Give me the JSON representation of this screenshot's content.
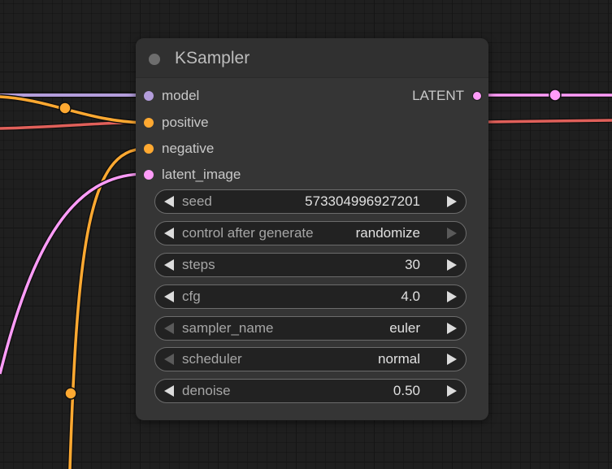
{
  "node": {
    "title": "KSampler",
    "inputs": [
      {
        "label": "model",
        "color": "#b39ddb"
      },
      {
        "label": "positive",
        "color": "#ffa931"
      },
      {
        "label": "negative",
        "color": "#ffa931"
      },
      {
        "label": "latent_image",
        "color": "#ff9cf9"
      }
    ],
    "outputs": [
      {
        "label": "LATENT",
        "color": "#ff9cf9"
      }
    ],
    "widgets": [
      {
        "label": "seed",
        "value": "573304996927201"
      },
      {
        "label": "control after generate",
        "value": "randomize"
      },
      {
        "label": "steps",
        "value": "30"
      },
      {
        "label": "cfg",
        "value": "4.0"
      },
      {
        "label": "sampler_name",
        "value": "euler"
      },
      {
        "label": "scheduler",
        "value": "normal"
      },
      {
        "label": "denoise",
        "value": "0.50"
      }
    ]
  },
  "colors": {
    "model_wire": "#b39ddb",
    "conditioning_wire": "#ffa931",
    "latent_wire": "#ff9cf9",
    "red_wire": "#e0605a"
  }
}
